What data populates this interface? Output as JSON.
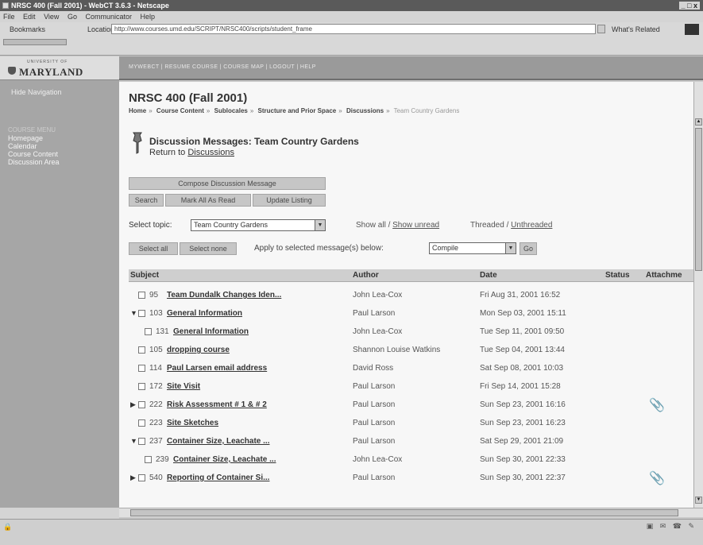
{
  "window": {
    "title": "NRSC 400 (Fall 2001) - WebCT 3.6.3 - Netscape",
    "controls": "_ □ x"
  },
  "menubar": [
    "File",
    "Edit",
    "View",
    "Go",
    "Communicator",
    "Help"
  ],
  "navbar": {
    "bookmarks": "Bookmarks",
    "location_label": "Location:",
    "url": "http://www.courses.umd.edu/SCRIPT/NRSC400/scripts/student_frame",
    "whats_related": "What's Related"
  },
  "leftnav": {
    "logo": "MARYLAND",
    "logo_small": "UNIVERSITY OF",
    "hide_nav": "Hide Navigation",
    "course_menu_title": "COURSE MENU",
    "items": [
      "Homepage",
      "Calendar",
      "Course Content",
      "Discussion Area"
    ]
  },
  "topbar": {
    "links": "MYWEBCT  |  RESUME COURSE  |  COURSE MAP  |  LOGOUT  |  HELP"
  },
  "page": {
    "title": "NRSC 400 (Fall 2001)",
    "breadcrumb": [
      "Home",
      "Course Content",
      "Sublocales",
      "Structure and Prior Space",
      "Discussions"
    ],
    "breadcrumb_current": "Team Country Gardens",
    "board_title": "Discussion Messages: Team Country Gardens",
    "return_prefix": "Return to",
    "return_link": "Discussions"
  },
  "buttons": {
    "compose": "Compose Discussion Message",
    "search": "Search",
    "mark_read": "Mark All As Read",
    "update": "Update Listing",
    "select_all": "Select all",
    "select_none": "Select none",
    "go": "Go"
  },
  "filters": {
    "select_topic_label": "Select topic:",
    "topic_value": "Team Country Gardens",
    "show_all": "Show all /",
    "show_unread": "Show unread",
    "threaded": "Threaded /",
    "unthreaded": "Unthreaded",
    "apply_label": "Apply to selected message(s) below:",
    "action_value": "Compile"
  },
  "table": {
    "headers": {
      "subject": "Subject",
      "author": "Author",
      "date": "Date",
      "status": "Status",
      "attachments": "Attachme"
    },
    "rows": [
      {
        "num": "95",
        "subject": "Team Dundalk Changes Iden...",
        "author": "John Lea-Cox",
        "date": "Fri Aug 31, 2001 16:52",
        "expander": "",
        "indent": 0,
        "attach": ""
      },
      {
        "num": "103",
        "subject": "General Information",
        "author": "Paul Larson",
        "date": "Mon Sep 03, 2001 15:11",
        "expander": "▼",
        "indent": 0,
        "attach": ""
      },
      {
        "num": "131",
        "subject": "General Information",
        "author": "John Lea-Cox",
        "date": "Tue Sep 11, 2001 09:50",
        "expander": "",
        "indent": 1,
        "attach": ""
      },
      {
        "num": "105",
        "subject": "dropping course",
        "author": "Shannon Louise Watkins",
        "date": "Tue Sep 04, 2001 13:44",
        "expander": "",
        "indent": 0,
        "attach": ""
      },
      {
        "num": "114",
        "subject": "Paul Larsen email address",
        "author": "David Ross",
        "date": "Sat Sep 08, 2001 10:03",
        "expander": "",
        "indent": 0,
        "attach": ""
      },
      {
        "num": "172",
        "subject": "Site Visit",
        "author": "Paul Larson",
        "date": "Fri Sep 14, 2001 15:28",
        "expander": "",
        "indent": 0,
        "attach": ""
      },
      {
        "num": "222",
        "subject": "Risk Assessment # 1 & # 2",
        "author": "Paul Larson",
        "date": "Sun Sep 23, 2001 16:16",
        "expander": "▶",
        "indent": 0,
        "attach": "📎"
      },
      {
        "num": "223",
        "subject": "Site Sketches",
        "author": "Paul Larson",
        "date": "Sun Sep 23, 2001 16:23",
        "expander": "",
        "indent": 0,
        "attach": ""
      },
      {
        "num": "237",
        "subject": "Container Size, Leachate ...",
        "author": "Paul Larson",
        "date": "Sat Sep 29, 2001 21:09",
        "expander": "▼",
        "indent": 0,
        "attach": ""
      },
      {
        "num": "239",
        "subject": "Container Size, Leachate ...",
        "author": "John Lea-Cox",
        "date": "Sun Sep 30, 2001 22:33",
        "expander": "",
        "indent": 1,
        "attach": ""
      },
      {
        "num": "540",
        "subject": "Reporting of Container Si...",
        "author": "Paul Larson",
        "date": "Sun Sep 30, 2001 22:37",
        "expander": "▶",
        "indent": 0,
        "attach": "📎"
      }
    ]
  },
  "colors": {
    "topbar": "#9a9a9a",
    "leftpanel": "#a6a6a6",
    "content": "#f7f7f7",
    "button": "#c6c6c6"
  }
}
